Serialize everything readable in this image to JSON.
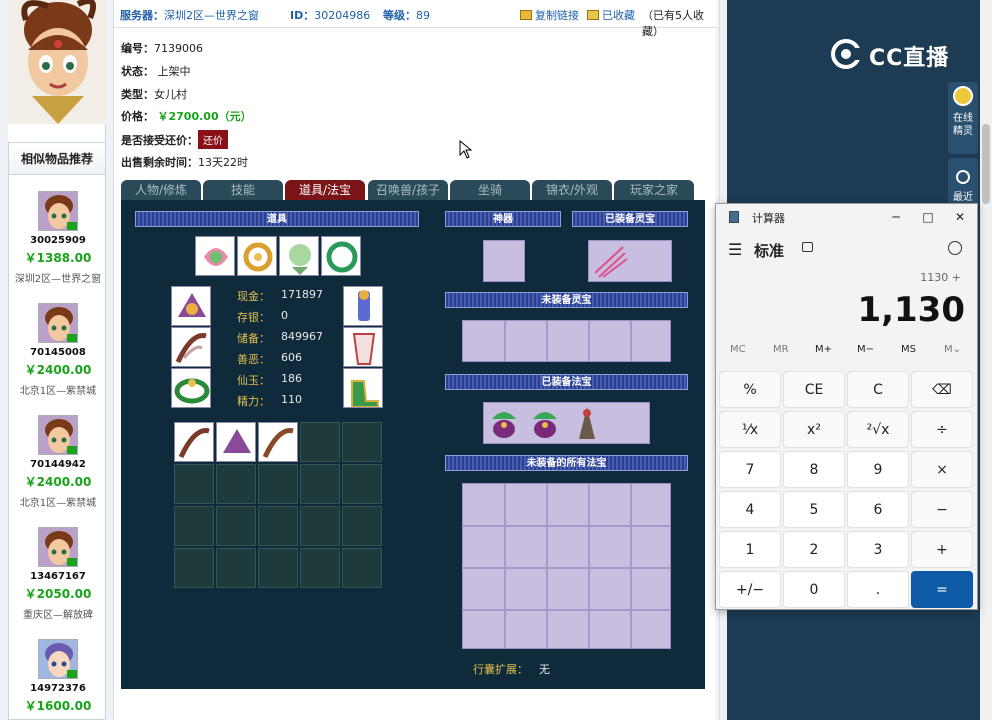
{
  "topbar": {
    "server_label": "服务器：",
    "server": "深圳2区—世界之窗",
    "id_label": "ID：",
    "id": "30204986",
    "level_label": "等级：",
    "level": "89",
    "copy_link": "复制链接",
    "favorite": "已收藏",
    "fav_count": "（已有5人收藏）"
  },
  "info": {
    "number_label": "编号：",
    "number": "7139006",
    "status_label": "状态：",
    "status": "上架中",
    "type_label": "类型：",
    "type": "女儿村",
    "price_label": "价格：",
    "price": "￥2700.00（元）",
    "bargain_label": "是否接受还价：",
    "bargain_button": "还价",
    "time_label": "出售剩余时间：",
    "time": "13天22时"
  },
  "tabs": [
    "人物/修炼",
    "技能",
    "道具/法宝",
    "召唤兽/孩子",
    "坐骑",
    "锦衣/外观",
    "玩家之家"
  ],
  "panel": {
    "items_header": "道具",
    "shenqi_header": "神器",
    "equipped_lingbao_header": "已装备灵宝",
    "unequipped_lingbao_header": "未装备灵宝",
    "equipped_fabao_header": "已装备法宝",
    "all_unequipped_fabao_header": "未装备的所有法宝",
    "expand_label": "行囊扩展：",
    "expand_value": "无",
    "stats": [
      {
        "label": "现金：",
        "value": "171897"
      },
      {
        "label": "存银：",
        "value": "0"
      },
      {
        "label": "储备：",
        "value": "849967"
      },
      {
        "label": "善恶：",
        "value": "606"
      },
      {
        "label": "仙玉：",
        "value": "186"
      },
      {
        "label": "精力：",
        "value": "110"
      }
    ]
  },
  "sidebar": {
    "title": "相似物品推荐",
    "items": [
      {
        "id": "30025909",
        "price": "￥1388.00",
        "server": "深圳2区—世界之窗"
      },
      {
        "id": "70145008",
        "price": "￥2400.00",
        "server": "北京1区—紫禁城"
      },
      {
        "id": "70144942",
        "price": "￥2400.00",
        "server": "北京1区—紫禁城"
      },
      {
        "id": "13467167",
        "price": "￥2050.00",
        "server": "重庆区—解放碑"
      },
      {
        "id": "14972376",
        "price": "￥1600.00",
        "server": ""
      }
    ]
  },
  "calculator": {
    "title": "计算器",
    "mode": "标准",
    "expression": "1130 +",
    "display": "1,130",
    "memory": [
      "MC",
      "MR",
      "M+",
      "M−",
      "MS",
      "M⌄"
    ],
    "keys": [
      "%",
      "CE",
      "C",
      "⌫",
      "¹⁄x",
      "x²",
      "²√x",
      "÷",
      "7",
      "8",
      "9",
      "×",
      "4",
      "5",
      "6",
      "−",
      "1",
      "2",
      "3",
      "+",
      "+/−",
      "0",
      ".",
      "="
    ]
  },
  "right": {
    "brand": "CC直播",
    "online_label": "在线精灵",
    "recent_label": "最近"
  },
  "colors": {
    "price_green": "#1aa21a",
    "tab_active": "#7a1418",
    "panel_bg": "#0f2a3a",
    "calc_equals": "#0e5aa7"
  }
}
